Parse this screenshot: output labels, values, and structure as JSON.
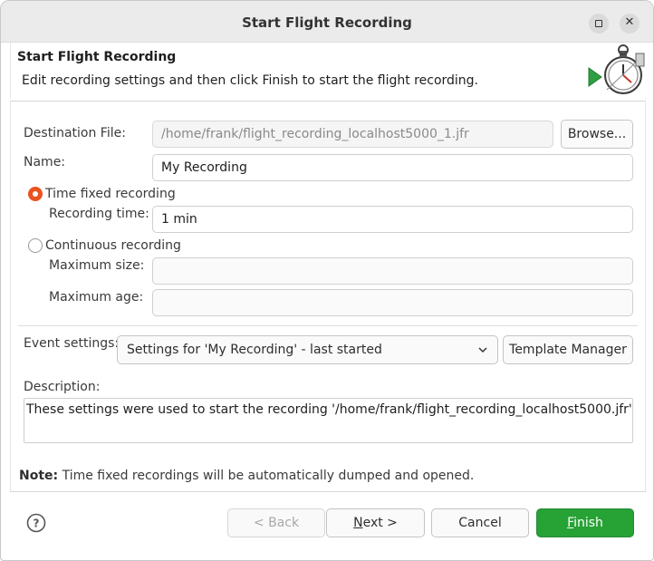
{
  "window": {
    "title": "Start Flight Recording"
  },
  "header": {
    "title": "Start Flight Recording",
    "message": "Edit recording settings and then click Finish to start the flight recording."
  },
  "form": {
    "destination_label": "Destination File:",
    "destination_value": "/home/frank/flight_recording_localhost5000_1.jfr",
    "browse_label": "Browse...",
    "name_label": "Name:",
    "name_value": "My Recording",
    "time_fixed_label": "Time fixed recording",
    "time_fixed_selected": true,
    "recording_time_label": "Recording time:",
    "recording_time_value": "1 min",
    "continuous_label": "Continuous recording",
    "continuous_selected": false,
    "max_size_label": "Maximum size:",
    "max_size_value": "",
    "max_age_label": "Maximum age:",
    "max_age_value": "",
    "event_settings_label": "Event settings:",
    "event_settings_value": "Settings for 'My Recording' - last started",
    "template_manager_label": "Template Manager",
    "description_label": "Description:",
    "description_value": "These settings were used to start the recording '/home/frank/flight_recording_localhost5000.jfr'."
  },
  "note": {
    "bold": "Note:",
    "text": " Time fixed recordings will be automatically dumped and opened."
  },
  "footer": {
    "back": "< Back",
    "next_mnemonic": "N",
    "next_rest": "ext >",
    "cancel": "Cancel",
    "finish_mnemonic": "F",
    "finish_rest": "inish"
  },
  "colors": {
    "accent_radio": "#e95420",
    "finish_button": "#27a235"
  },
  "icons": [
    "minimize-icon",
    "close-icon",
    "stopwatch-wizard-icon",
    "chevron-down-icon",
    "help-icon"
  ]
}
